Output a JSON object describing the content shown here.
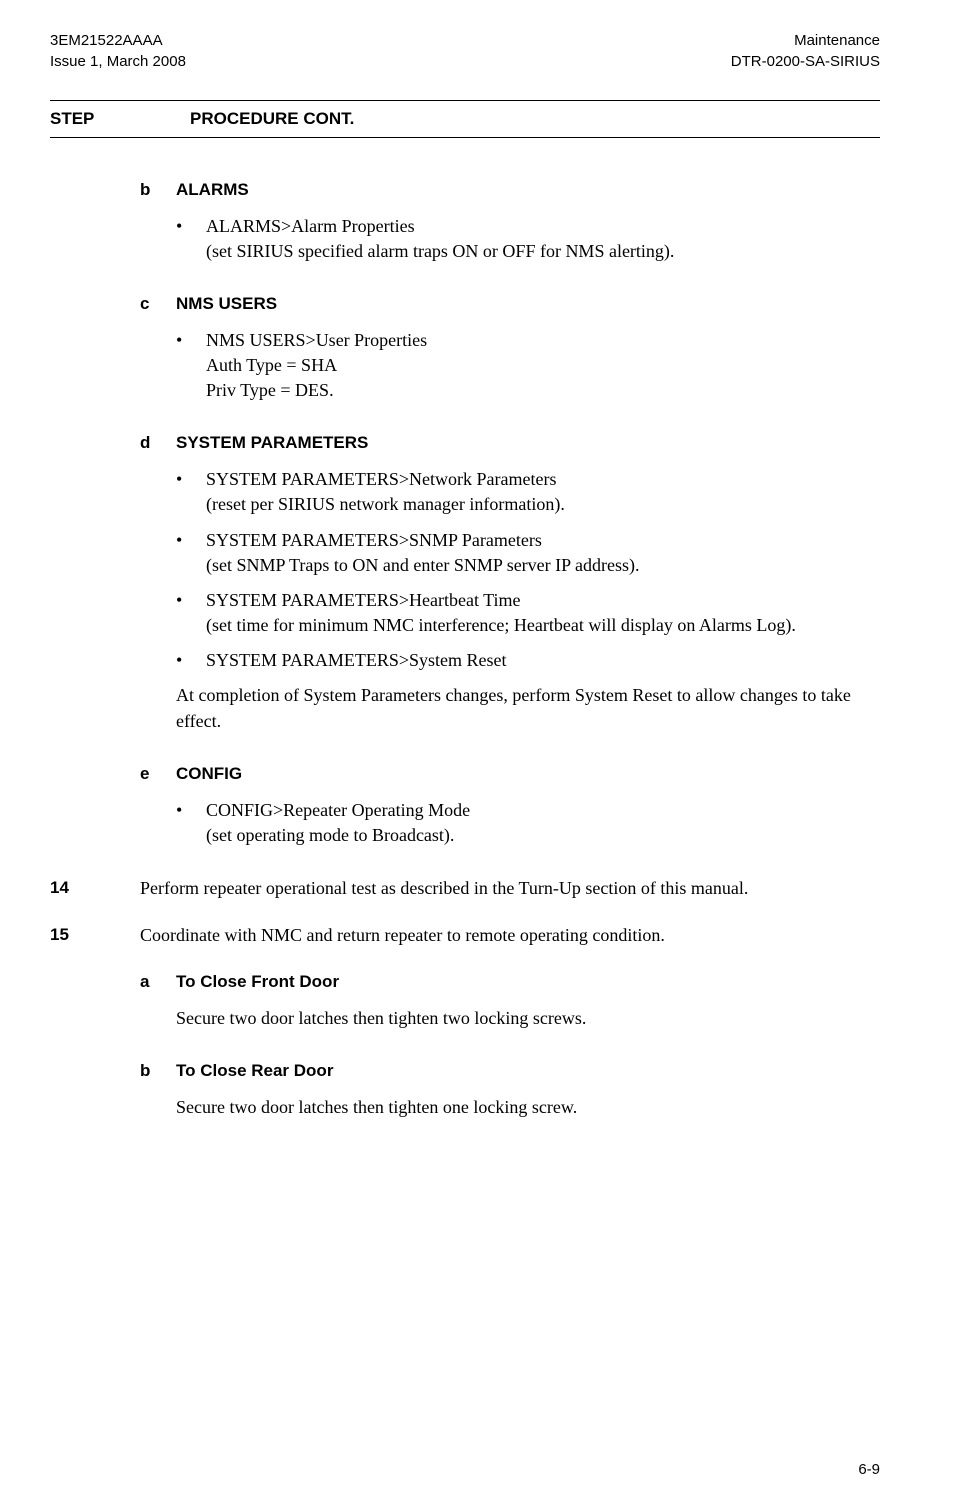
{
  "header": {
    "left_line1": "3EM21522AAAA",
    "left_line2": "Issue 1, March 2008",
    "right_line1": "Maintenance",
    "right_line2": "DTR-0200-SA-SIRIUS"
  },
  "section_header": {
    "step": "STEP",
    "procedure": "PROCEDURE CONT."
  },
  "item_b": {
    "letter": "b",
    "title": "ALARMS",
    "bullets": [
      {
        "main": "ALARMS>Alarm Properties",
        "sub": "(set SIRIUS specified alarm traps ON or OFF for NMS alerting)."
      }
    ]
  },
  "item_c": {
    "letter": "c",
    "title": "NMS USERS",
    "bullets": [
      {
        "main": "NMS USERS>User Properties",
        "line2": "Auth Type = SHA",
        "line3": "Priv Type = DES."
      }
    ]
  },
  "item_d": {
    "letter": "d",
    "title": "SYSTEM PARAMETERS",
    "bullets": [
      {
        "main": "SYSTEM PARAMETERS>Network Parameters",
        "sub": "(reset per SIRIUS network manager information)."
      },
      {
        "main": "SYSTEM PARAMETERS>SNMP Parameters",
        "sub": "(set SNMP Traps to ON and enter SNMP server IP address)."
      },
      {
        "main": "SYSTEM PARAMETERS>Heartbeat Time",
        "sub": "(set time for minimum NMC interference; Heartbeat will display on Alarms Log)."
      },
      {
        "main": "SYSTEM PARAMETERS>System Reset"
      }
    ],
    "note": "At completion of System Parameters changes, perform System Reset to allow changes to take effect."
  },
  "item_e": {
    "letter": "e",
    "title": "CONFIG",
    "bullets": [
      {
        "main": "CONFIG>Repeater Operating Mode",
        "sub": "(set operating mode to Broadcast)."
      }
    ]
  },
  "step14": {
    "number": "14",
    "text": "Perform repeater operational test as described in the Turn-Up section of this manual."
  },
  "step15": {
    "number": "15",
    "text": "Coordinate with NMC and return repeater to remote operating condition."
  },
  "item_15a": {
    "letter": "a",
    "title": "To Close Front Door",
    "body": "Secure two door latches then tighten two locking screws."
  },
  "item_15b": {
    "letter": "b",
    "title": "To Close Rear Door",
    "body": "Secure two door latches then tighten one locking screw."
  },
  "page_number": "6-9"
}
